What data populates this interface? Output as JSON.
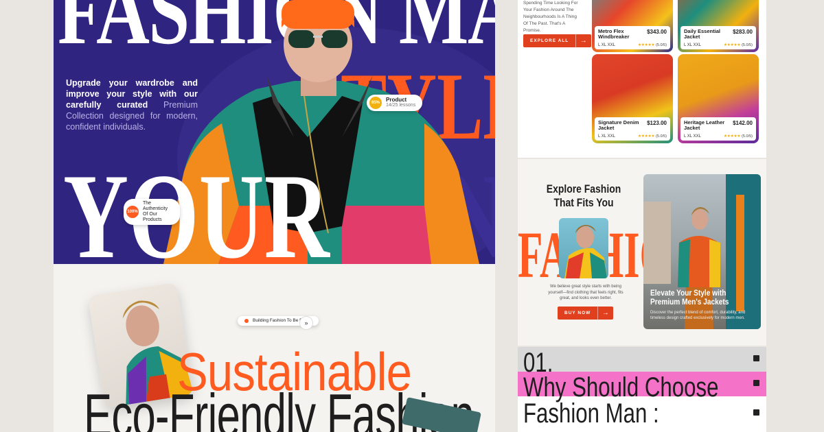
{
  "hero": {
    "word_fashion_man": "FASHION MAN",
    "word_style": "STYLE",
    "word_your": "YOUR",
    "word_on": "ON",
    "blurb_bold": "Upgrade your wardrobe and improve your style with our carefully curated",
    "blurb_light": "Premium Collection designed for modern, confident individuals.",
    "badge_product": {
      "percent": "85%",
      "title": "Product",
      "sub": "14/25 lessons"
    },
    "badge_authentic": {
      "percent": "100%",
      "text": "The Authenticity Of Our Products"
    }
  },
  "lower": {
    "tag": "Building Fashion To Be Better",
    "tag_icon": "chevrons-right-icon",
    "headline_1": "Sustainable",
    "headline_2": "Eco-Friendly Fashion"
  },
  "shop": {
    "intro": "Spending Time Looking For Your Fashion Around The Neighbourhoods Is A Thing Of The Past. That's A Promise.",
    "explore_label": "EXPLORE ALL",
    "products": [
      {
        "name": "Metro Flex Windbreaker",
        "price": "$343.00",
        "sizes": "L  XL  XXL",
        "rating": "(5.0/5)"
      },
      {
        "name": "Daily Essential Jacket",
        "price": "$283.00",
        "sizes": "L  XL  XXL",
        "rating": "(5.0/5)"
      },
      {
        "name": "Signature Denim Jacket",
        "price": "$123.00",
        "sizes": "L  XL  XXL",
        "rating": "(5.0/5)"
      },
      {
        "name": "Heritage Leather Jacket",
        "price": "$142.00",
        "sizes": "L  XL  XXL",
        "rating": "(5.0/5)"
      }
    ],
    "stars": "★★★★★"
  },
  "explore": {
    "heading": "Explore Fashion That Fits You",
    "bigword": "FASHION",
    "small": "We believe great style starts with being yourself—find clothing that feels right, fits great, and looks even better.",
    "buy_label": "BUY NOW",
    "feature_title": "Elevate Your Style with Premium Men's Jackets",
    "feature_desc": "Discover the perfect blend of comfort, durability, and timeless design crafted exclusively for modern men."
  },
  "why": {
    "line1": "01.",
    "line2": "Why Should Choose",
    "line3": "Fashion Man :"
  },
  "colors": {
    "accent": "#ff5a1f",
    "hero_bg": "#2f2580",
    "pink": "#f472c8"
  }
}
